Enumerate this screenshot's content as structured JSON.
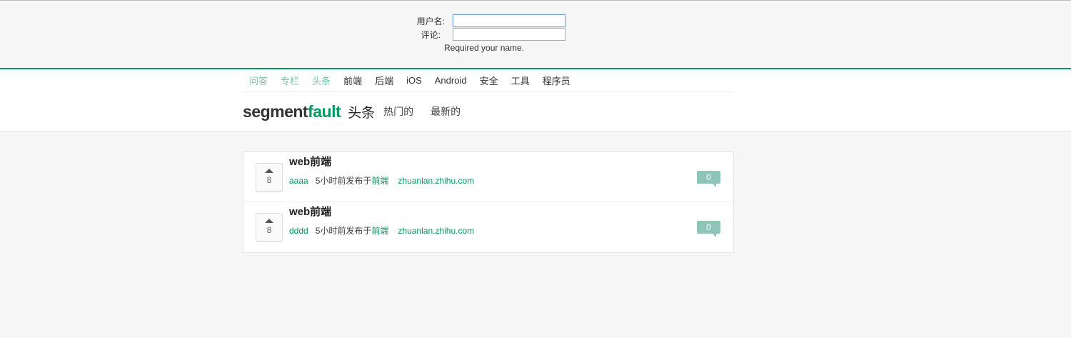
{
  "form": {
    "username_label": "用户名:",
    "username_value": "",
    "comment_label": "评论:",
    "comment_value": "",
    "hint": "Required your name."
  },
  "topnav": [
    {
      "label": "问答",
      "muted": true
    },
    {
      "label": "专栏",
      "muted": true
    },
    {
      "label": "头条",
      "muted": true
    },
    {
      "label": "前端",
      "muted": false
    },
    {
      "label": "后端",
      "muted": false
    },
    {
      "label": "iOS",
      "muted": false
    },
    {
      "label": "Android",
      "muted": false
    },
    {
      "label": "安全",
      "muted": false
    },
    {
      "label": "工具",
      "muted": false
    },
    {
      "label": "程序员",
      "muted": false
    }
  ],
  "brand": {
    "logo_part1": "segment",
    "logo_part2": "fault",
    "section": "头条",
    "hot": "热门的",
    "latest": "最新的"
  },
  "items": [
    {
      "votes": "8",
      "title": "web前端",
      "author": "aaaa",
      "time_text": "5小时前发布于",
      "tag": "前端",
      "domain": "zhuanlan.zhihu.com",
      "comments": "0"
    },
    {
      "votes": "8",
      "title": "web前端",
      "author": "dddd",
      "time_text": "5小时前发布于",
      "tag": "前端",
      "domain": "zhuanlan.zhihu.com",
      "comments": "0"
    }
  ],
  "colors": {
    "brand_green": "#009a61",
    "muted_green": "#7cc4a6",
    "badge": "#8ec5b8",
    "background": "#f6f6f6"
  },
  "icons": {
    "vote_up": "caret-up-icon",
    "comment": "comment-bubble-icon"
  }
}
